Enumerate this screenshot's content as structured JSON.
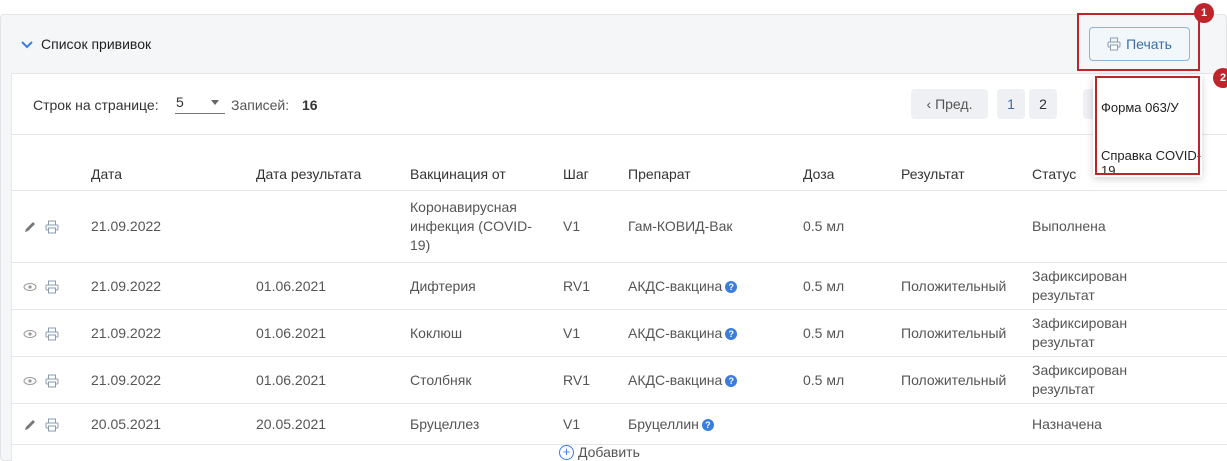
{
  "panel": {
    "title": "Список прививок"
  },
  "print": {
    "label": "Печать",
    "menu": [
      "Форма 063/У",
      "Справка COVID-19"
    ]
  },
  "badges": [
    "1",
    "2"
  ],
  "toolbar": {
    "rows_label": "Строк на странице:",
    "rows_value": "5",
    "records_label": "Записей:",
    "records_value": "16"
  },
  "pager": {
    "prev": "‹ Пред.",
    "page1": "1",
    "page2": "2"
  },
  "table": {
    "headers": [
      "",
      "Дата",
      "Дата результата",
      "Вакцинация от",
      "Шаг",
      "Препарат",
      "Доза",
      "Результат",
      "Статус"
    ],
    "rows": [
      {
        "action": "edit",
        "date": "21.09.2022",
        "result_date": "",
        "vaccination": "Коронавирусная инфекция (COVID-19)",
        "step": "V1",
        "drug": "Гам-КОВИД-Вак",
        "drug_help": false,
        "dose": "0.5 мл",
        "result": "",
        "status": "Выполнена"
      },
      {
        "action": "view",
        "date": "21.09.2022",
        "result_date": "01.06.2021",
        "vaccination": "Дифтерия",
        "step": "RV1",
        "drug": "АКДС-вакцина",
        "drug_help": true,
        "dose": "0.5 мл",
        "result": "Положительный",
        "status": "Зафиксирован результат"
      },
      {
        "action": "view",
        "date": "21.09.2022",
        "result_date": "01.06.2021",
        "vaccination": "Коклюш",
        "step": "V1",
        "drug": "АКДС-вакцина",
        "drug_help": true,
        "dose": "0.5 мл",
        "result": "Положительный",
        "status": "Зафиксирован результат"
      },
      {
        "action": "view",
        "date": "21.09.2022",
        "result_date": "01.06.2021",
        "vaccination": "Столбняк",
        "step": "RV1",
        "drug": "АКДС-вакцина",
        "drug_help": true,
        "dose": "0.5 мл",
        "result": "Положительный",
        "status": "Зафиксирован результат"
      },
      {
        "action": "edit",
        "date": "20.05.2021",
        "result_date": "20.05.2021",
        "vaccination": "Бруцеллез",
        "step": "V1",
        "drug": "Бруцеллин",
        "drug_help": true,
        "dose": "",
        "result": "",
        "status": "Назначена"
      }
    ]
  },
  "add": {
    "label": "Добавить"
  },
  "colors": {
    "accent": "#3b7ddd",
    "highlight": "#c0242b",
    "button_text": "#3b6ea5"
  }
}
